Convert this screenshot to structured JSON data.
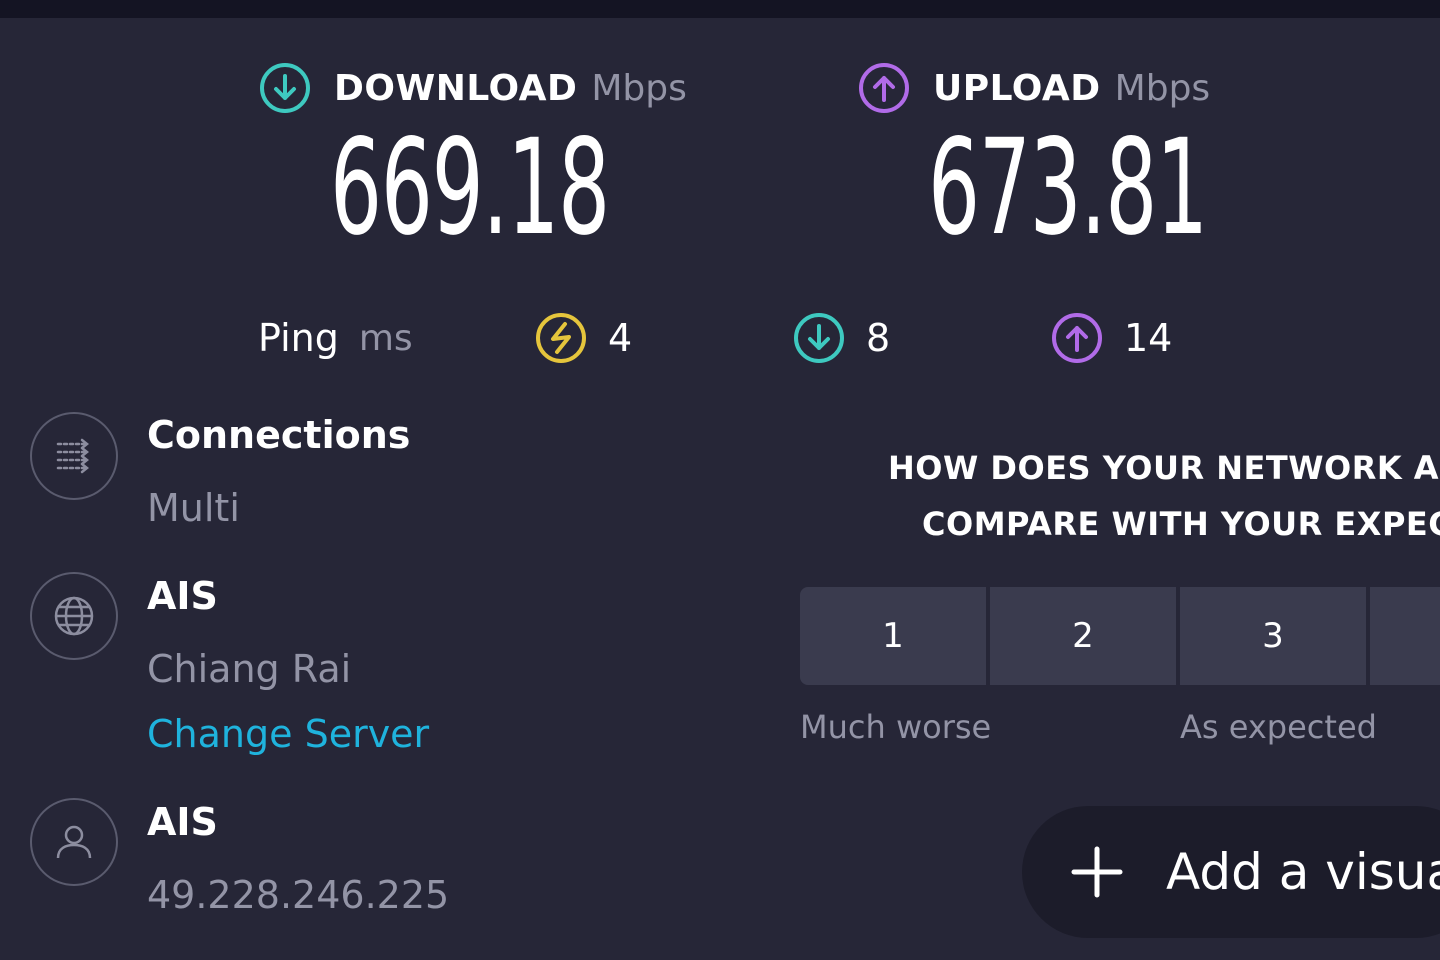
{
  "speeds": {
    "download": {
      "label": "DOWNLOAD",
      "unit": "Mbps",
      "value": "669.18",
      "icon": "download-arrow-icon",
      "color": "#3ec9c0"
    },
    "upload": {
      "label": "UPLOAD",
      "unit": "Mbps",
      "value": "673.81",
      "icon": "upload-arrow-icon",
      "color": "#b16be8"
    }
  },
  "ping": {
    "label": "Ping",
    "unit": "ms",
    "idle": {
      "value": "4",
      "icon": "ping-idle-icon",
      "color": "#e5c53c"
    },
    "download": {
      "value": "8",
      "icon": "ping-download-icon",
      "color": "#3ec9c0"
    },
    "upload": {
      "value": "14",
      "icon": "ping-upload-icon",
      "color": "#b16be8"
    }
  },
  "connections": {
    "title": "Connections",
    "value": "Multi",
    "icon": "connections-icon"
  },
  "server": {
    "title": "AIS",
    "location": "Chiang Rai",
    "change_link": "Change Server",
    "icon": "globe-icon"
  },
  "provider": {
    "title": "AIS",
    "ip": "49.228.246.225",
    "icon": "user-icon"
  },
  "survey": {
    "question_line1": "HOW DOES YOUR NETWORK A",
    "question_line2": "COMPARE WITH YOUR EXPEC",
    "ratings": [
      "1",
      "2",
      "3"
    ],
    "low_label": "Much worse",
    "mid_label": "As expected"
  },
  "add_visual": {
    "label": "Add a visua",
    "icon": "plus-icon"
  },
  "colors": {
    "background": "#262637",
    "link": "#1fb3dd",
    "muted": "#9394a6"
  }
}
